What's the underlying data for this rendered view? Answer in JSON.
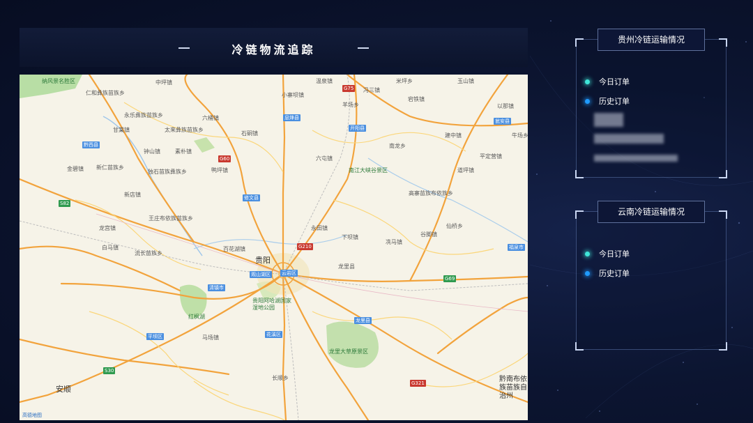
{
  "header": {
    "title": "冷链物流追踪"
  },
  "map": {
    "provider_mark": "高德地图",
    "major_city": "贵阳",
    "labels": [
      {
        "t": "纳风景名胜区",
        "k": "park"
      },
      {
        "t": "中坪镇"
      },
      {
        "t": "温泉镇"
      },
      {
        "t": "冯三镇"
      },
      {
        "t": "米坪乡"
      },
      {
        "t": "玉山镇"
      },
      {
        "t": "仁和彝族苗族乡"
      },
      {
        "t": "小寨坝镇"
      },
      {
        "t": "羊场乡"
      },
      {
        "t": "宕铁镇"
      },
      {
        "t": "以那镇"
      },
      {
        "t": "永乐彝族苗族乡"
      },
      {
        "t": "六桶镇"
      },
      {
        "t": "息烽县"
      },
      {
        "t": "开阳县"
      },
      {
        "t": "瓮安县"
      },
      {
        "t": "牛场乡"
      },
      {
        "t": "甘棠镇"
      },
      {
        "t": "太来彝族苗族乡"
      },
      {
        "t": "石硐镇"
      },
      {
        "t": "南龙乡"
      },
      {
        "t": "建中镇"
      },
      {
        "t": "黔西县"
      },
      {
        "t": "钟山镇"
      },
      {
        "t": "素朴镇"
      },
      {
        "t": "六屯镇"
      },
      {
        "t": "南江大峡谷景区",
        "k": "park"
      },
      {
        "t": "平定营镇"
      },
      {
        "t": "金碧镇"
      },
      {
        "t": "新仁苗族乡"
      },
      {
        "t": "独石苗族彝族乡"
      },
      {
        "t": "鸭坪镇"
      },
      {
        "t": "道坪镇"
      },
      {
        "t": "修文县"
      },
      {
        "t": "高寨苗族布依族乡"
      },
      {
        "t": "新店镇"
      },
      {
        "t": "王庄布依族苗族乡"
      },
      {
        "t": "仙桥乡"
      },
      {
        "t": "龙宫镇"
      },
      {
        "t": "永田镇"
      },
      {
        "t": "下坝镇"
      },
      {
        "t": "谷脚镇"
      },
      {
        "t": "冼马镇"
      },
      {
        "t": "福泉市"
      },
      {
        "t": "白马镇"
      },
      {
        "t": "流长苗族乡"
      },
      {
        "t": "百花湖镇"
      },
      {
        "t": "贵阳"
      },
      {
        "t": "龙里县"
      },
      {
        "t": "观山湖区"
      },
      {
        "t": "云岩区"
      },
      {
        "t": "清镇市"
      },
      {
        "t": "贵阳阿哈湖国家湿地公园",
        "k": "park"
      },
      {
        "t": "红枫湖",
        "k": "park"
      },
      {
        "t": "龙里大草原景区",
        "k": "park"
      },
      {
        "t": "龙里县"
      },
      {
        "t": "平坝区"
      },
      {
        "t": "花溪区"
      },
      {
        "t": "马场镇"
      },
      {
        "t": "黔南布依族苗族自治州",
        "k": "big"
      },
      {
        "t": "安顺"
      },
      {
        "t": "长顺乡"
      }
    ],
    "road_badges": [
      "G75",
      "G60",
      "G69",
      "S82",
      "G321",
      "G210",
      "S30"
    ]
  },
  "panels": [
    {
      "title": "贵州冷链运输情况",
      "legend": [
        {
          "label": "今日订单",
          "color": "#3fe6d8"
        },
        {
          "label": "历史订单",
          "color": "#1f9bff"
        }
      ]
    },
    {
      "title": "云南冷链运输情况",
      "legend": [
        {
          "label": "今日订单",
          "color": "#3fe6d8"
        },
        {
          "label": "历史订单",
          "color": "#1f9bff"
        }
      ]
    }
  ]
}
